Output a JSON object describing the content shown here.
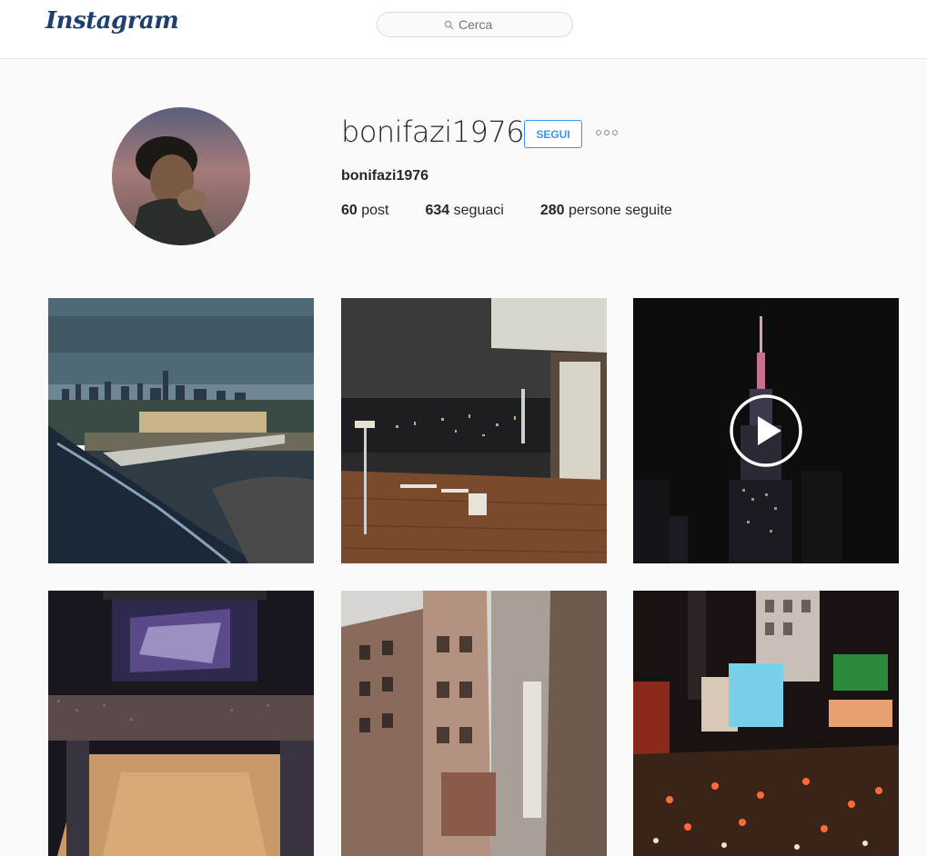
{
  "header": {
    "logo": "Instagram",
    "search_placeholder": "Cerca"
  },
  "profile": {
    "username": "bonifazi1976",
    "full_name": "bonifazi1976",
    "follow_label": "SEGUI",
    "stats": {
      "posts_count": "60",
      "posts_label": "post",
      "followers_count": "634",
      "followers_label": "seguaci",
      "following_count": "280",
      "following_label": "persone seguite"
    }
  },
  "posts": [
    {
      "type": "photo"
    },
    {
      "type": "photo"
    },
    {
      "type": "video"
    },
    {
      "type": "photo"
    },
    {
      "type": "photo"
    },
    {
      "type": "photo"
    }
  ],
  "colors": {
    "accent": "#3897f0",
    "logo": "#1f3f6e"
  }
}
